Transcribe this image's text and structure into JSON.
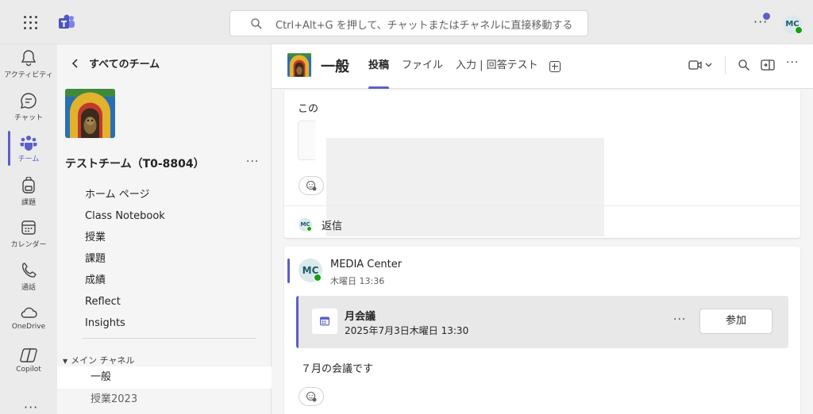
{
  "search": {
    "placeholder": "Ctrl+Alt+G を押して、チャットまたはチャネルに直接移動する"
  },
  "user": {
    "initials": "MC"
  },
  "rail": [
    {
      "label": "アクティビティ",
      "icon": "bell-icon"
    },
    {
      "label": "チャット",
      "icon": "chat-icon"
    },
    {
      "label": "チーム",
      "icon": "teams-icon",
      "active": true
    },
    {
      "label": "課題",
      "icon": "backpack-icon"
    },
    {
      "label": "カレンダー",
      "icon": "calendar-icon"
    },
    {
      "label": "通話",
      "icon": "phone-icon"
    },
    {
      "label": "OneDrive",
      "icon": "cloud-icon"
    },
    {
      "label": "Copilot",
      "icon": "copilot-icon"
    }
  ],
  "panel": {
    "back_label": "すべてのチーム",
    "team_name": "テストチーム（T0-8804）",
    "nav": [
      "ホーム ページ",
      "Class Notebook",
      "授業",
      "課題",
      "成績",
      "Reflect",
      "Insights"
    ],
    "section_label": "メイン チャネル",
    "channels": [
      "一般",
      "授業2023"
    ]
  },
  "channel": {
    "title": "一般",
    "tabs": [
      "投稿",
      "ファイル",
      "入力 | 回答テスト"
    ]
  },
  "post1": {
    "fragment": "この",
    "reply_label": "返信",
    "reply_avatar": "MC"
  },
  "post2": {
    "author_initials": "MC",
    "author": "MEDIA Center",
    "time": "木曜日 13:36",
    "meeting_title": "月会議",
    "meeting_date": "2025年7月3日木曜日 13:30",
    "join_label": "参加",
    "body": "７月の会議です"
  },
  "colors": {
    "accent": "#5b5fc7",
    "presence": "#13a10e"
  }
}
